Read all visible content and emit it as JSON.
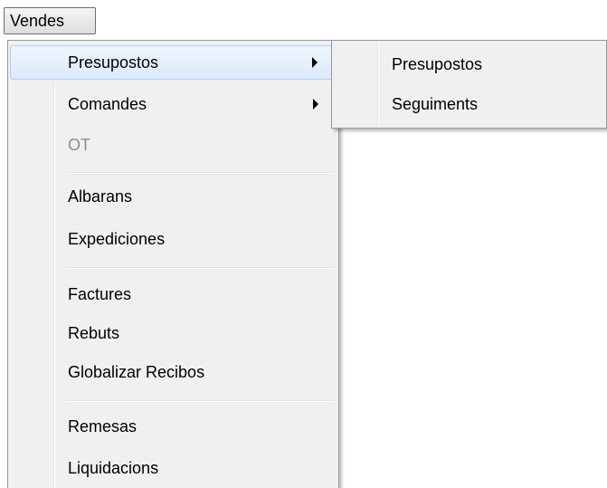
{
  "menubar": {
    "vendes_label": "Vendes"
  },
  "main_menu": {
    "items": [
      {
        "label": "Presupostos"
      },
      {
        "label": "Comandes"
      },
      {
        "label": "OT"
      },
      {
        "label": "Albarans"
      },
      {
        "label": "Expediciones"
      },
      {
        "label": "Factures"
      },
      {
        "label": "Rebuts"
      },
      {
        "label": "Globalizar Recibos"
      },
      {
        "label": "Remesas"
      },
      {
        "label": "Liquidacions"
      }
    ]
  },
  "submenu": {
    "items": [
      {
        "label": "Presupostos"
      },
      {
        "label": "Seguiments"
      }
    ]
  }
}
